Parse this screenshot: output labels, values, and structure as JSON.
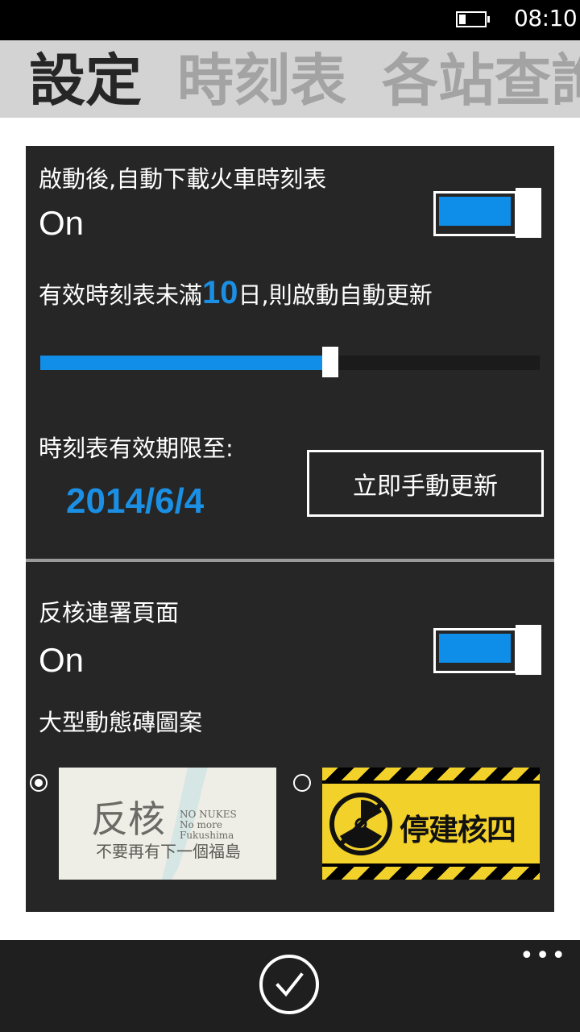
{
  "status_bar": {
    "time": "08:10"
  },
  "pivot": {
    "tabs": [
      "設定",
      "時刻表",
      "各站查詢"
    ],
    "active_index": 0
  },
  "auto_download": {
    "label": "啟動後,自動下載火車時刻表",
    "state_text": "On",
    "toggle_on": true
  },
  "auto_update": {
    "prefix": "有效時刻表未滿",
    "days": "10",
    "suffix": "日,則啟動自動更新",
    "slider_fraction": 0.58
  },
  "validity": {
    "label": "時刻表有效期限至:",
    "date": "2014/6/4",
    "manual_update_button": "立即手動更新"
  },
  "anti_nuclear": {
    "label": "反核連署頁面",
    "state_text": "On",
    "toggle_on": true,
    "tile_label": "大型動態磚圖案",
    "options": [
      {
        "selected": true,
        "title": "反核",
        "subtitle_small_1": "NO NUKES",
        "subtitle_small_2": "No more Fukushima",
        "caption": "不要再有下一個福島"
      },
      {
        "selected": false,
        "caption": "停建核四"
      }
    ]
  },
  "colors": {
    "accent": "#1a8fe3",
    "panel": "#262626",
    "header": "#d3d3d3",
    "appbar": "#1f1f1f",
    "warning_yellow": "#f2d12a"
  },
  "app_bar": {
    "primary_icon": "check-icon",
    "more": "•••"
  }
}
